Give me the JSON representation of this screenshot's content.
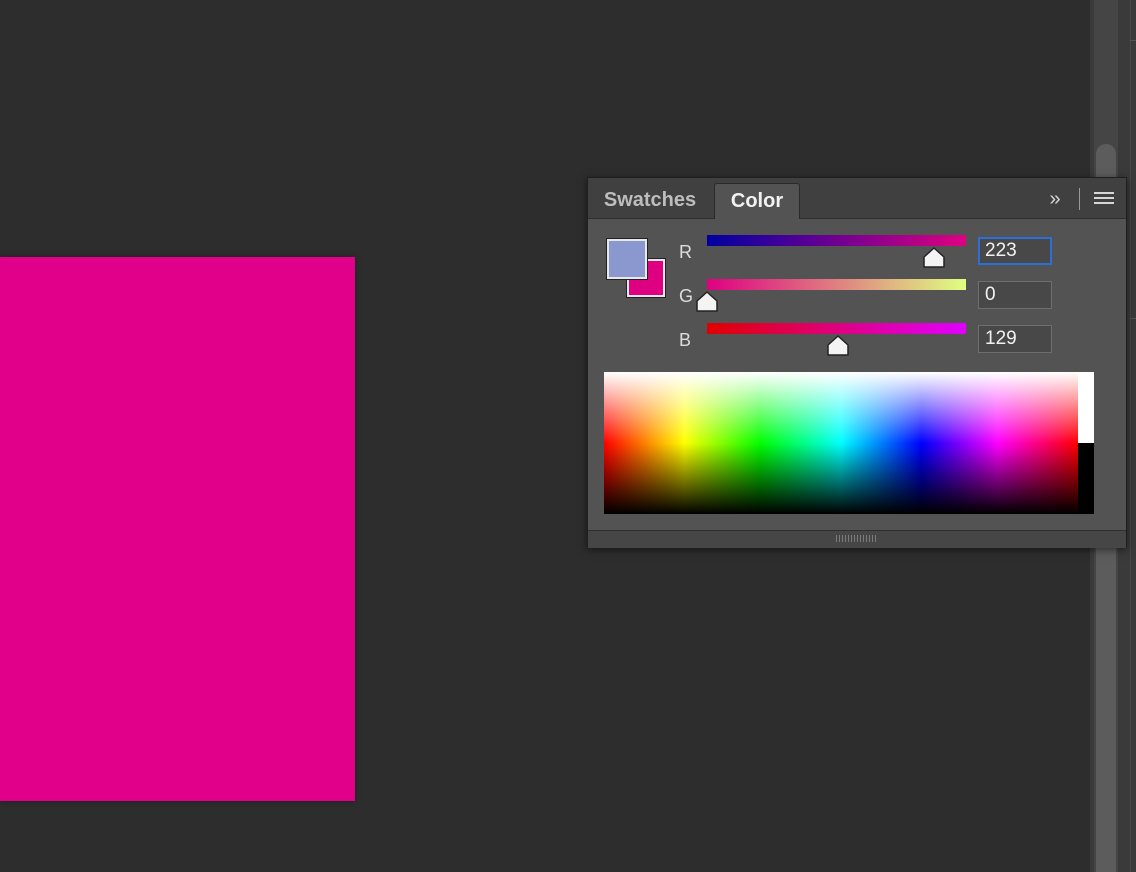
{
  "canvas": {
    "document_color": "#e0008a"
  },
  "panel": {
    "tabs": [
      {
        "label": "Swatches",
        "active": false
      },
      {
        "label": "Color",
        "active": true
      }
    ],
    "expand_icon_glyph": "»",
    "expand_icon": "double-chevron-right-icon",
    "menu_icon": "hamburger-menu-icon"
  },
  "color": {
    "foreground": "#8b98cf",
    "background": "#df0081",
    "channels": [
      {
        "label": "R",
        "value": "223",
        "fraction": 0.875,
        "gradient": [
          "#0000a0",
          "#df0081"
        ]
      },
      {
        "label": "G",
        "value": "0",
        "fraction": 0.0,
        "gradient": [
          "#df0081",
          "#dfff81"
        ]
      },
      {
        "label": "B",
        "value": "129",
        "fraction": 0.506,
        "gradient": [
          "#df0000",
          "#df00ff"
        ]
      }
    ]
  },
  "accent": {
    "focus_ring": "#2d6fd8"
  }
}
